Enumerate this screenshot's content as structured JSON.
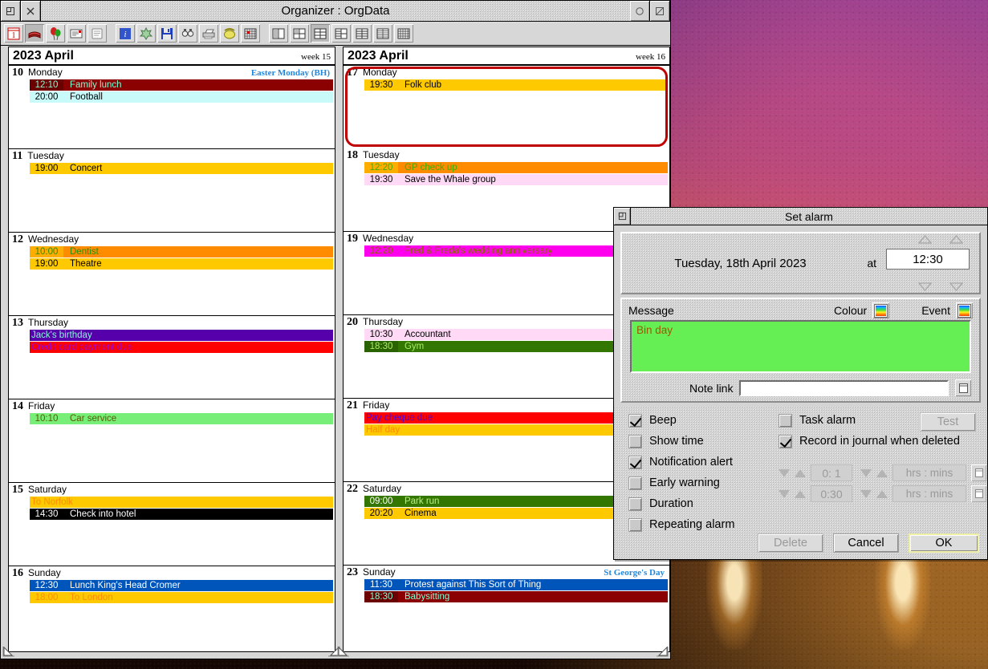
{
  "desktop": {
    "background_note": "abstract purple-orange photo"
  },
  "window": {
    "title": "Organizer : OrgData",
    "titlebar_buttons": [
      {
        "name": "toggle-size",
        "glyph": "box"
      },
      {
        "name": "close",
        "glyph": "x"
      },
      {
        "name": "toggle-full-size",
        "glyph": "circle"
      },
      {
        "name": "adjust-size",
        "glyph": "arrow"
      }
    ],
    "toolbar": [
      {
        "name": "calendar-icon",
        "label": "Calendar",
        "selected": false
      },
      {
        "name": "address-book-icon",
        "label": "Address book",
        "selected": true
      },
      {
        "name": "balloons-icon",
        "label": "Anniversaries",
        "selected": false
      },
      {
        "name": "notes-icon",
        "label": "Notes",
        "selected": false
      },
      {
        "name": "todo-icon",
        "label": "To do",
        "selected": false
      },
      {
        "name": "info-icon",
        "label": "Info",
        "selected": false
      },
      {
        "name": "settings-icon",
        "label": "Settings",
        "selected": false
      },
      {
        "name": "save-icon",
        "label": "Save",
        "selected": false
      },
      {
        "name": "find-icon",
        "label": "Find",
        "selected": false
      },
      {
        "name": "print-icon",
        "label": "Print",
        "selected": false
      },
      {
        "name": "phone-icon",
        "label": "Dial",
        "selected": false
      },
      {
        "name": "grid-icon",
        "label": "Year view",
        "selected": false
      },
      {
        "name": "view-1-icon",
        "label": "One column view",
        "selected": false
      },
      {
        "name": "view-2-icon",
        "label": "Two column view",
        "selected": false
      },
      {
        "name": "view-3-icon",
        "label": "Week view",
        "selected": true
      },
      {
        "name": "view-4-icon",
        "label": "Split view",
        "selected": false
      },
      {
        "name": "view-5-icon",
        "label": "Two week view",
        "selected": false
      },
      {
        "name": "view-6-icon",
        "label": "Month list view",
        "selected": false
      },
      {
        "name": "view-7-icon",
        "label": "Month grid view",
        "selected": false
      }
    ]
  },
  "panes": [
    {
      "month": "2023 April",
      "week": "week 15",
      "days": [
        {
          "num": "10",
          "name": "Monday",
          "note": "Easter Monday (BH)",
          "selected": false,
          "entries": [
            {
              "time": "12:10",
              "text": "Family lunch",
              "bar_bg": "#8b0000",
              "bar_fg": "#7fffd4",
              "time_bg": "#6b0000",
              "time_fg": "#7fffd4"
            },
            {
              "time": "20:00",
              "text": "Football",
              "bar_bg": "#c8fafa",
              "bar_fg": "#000000",
              "time_bg": "#c8fafa",
              "time_fg": "#000000"
            }
          ]
        },
        {
          "num": "11",
          "name": "Tuesday",
          "note": "",
          "selected": false,
          "entries": [
            {
              "time": "19:00",
              "text": "Concert",
              "bar_bg": "#ffc900",
              "bar_fg": "#000000",
              "time_bg": "#ffc900",
              "time_fg": "#000000"
            }
          ]
        },
        {
          "num": "12",
          "name": "Wednesday",
          "note": "",
          "selected": false,
          "entries": [
            {
              "time": "10:00",
              "text": "Dentist",
              "bar_bg": "#ff8c00",
              "bar_fg": "#2e8b00",
              "time_bg": "#ffae00",
              "time_fg": "#2e8b00"
            },
            {
              "time": "19:00",
              "text": "Theatre",
              "bar_bg": "#ffc900",
              "bar_fg": "#000000",
              "time_bg": "#ffc900",
              "time_fg": "#000000"
            }
          ]
        },
        {
          "num": "13",
          "name": "Thursday",
          "note": "",
          "selected": false,
          "entries": [
            {
              "time": "",
              "text": "Jack's birthday",
              "bar_bg": "#5500aa",
              "bar_fg": "#7fffd4",
              "time_bg": "#5500aa",
              "time_fg": "#7fffd4"
            },
            {
              "time": "",
              "text": "Credit card payment due",
              "bar_bg": "#ff0000",
              "bar_fg": "#9900cc",
              "time_bg": "#ff0000",
              "time_fg": "#9900cc"
            }
          ]
        },
        {
          "num": "14",
          "name": "Friday",
          "note": "",
          "selected": false,
          "entries": [
            {
              "time": "10:10",
              "text": "Car service",
              "bar_bg": "#77ee77",
              "bar_fg": "#5a5a00",
              "time_bg": "#77ee77",
              "time_fg": "#5a5a00"
            }
          ]
        },
        {
          "num": "15",
          "name": "Saturday",
          "note": "",
          "selected": false,
          "entries": [
            {
              "time": "",
              "text": "To Norfolk",
              "bar_bg": "#ffc900",
              "bar_fg": "#ff8c00",
              "time_bg": "#ffc900",
              "time_fg": "#ff8c00"
            },
            {
              "time": "14:30",
              "text": "Check into hotel",
              "bar_bg": "#000000",
              "bar_fg": "#ffffff",
              "time_bg": "#000000",
              "time_fg": "#ffffff"
            }
          ]
        },
        {
          "num": "16",
          "name": "Sunday",
          "note": "",
          "selected": false,
          "entries": [
            {
              "time": "12:30",
              "text": "Lunch King's Head Cromer",
              "bar_bg": "#0055bb",
              "bar_fg": "#ffffff",
              "time_bg": "#0055bb",
              "time_fg": "#ffffff"
            },
            {
              "time": "18:00",
              "text": "To London",
              "bar_bg": "#ffc900",
              "bar_fg": "#ff8c00",
              "time_bg": "#ffc900",
              "time_fg": "#ff8c00"
            }
          ]
        }
      ]
    },
    {
      "month": "2023 April",
      "week": "week 16",
      "days": [
        {
          "num": "17",
          "name": "Monday",
          "note": "",
          "selected": true,
          "entries": [
            {
              "time": "19:30",
              "text": "Folk club",
              "bar_bg": "#ffc900",
              "bar_fg": "#000000",
              "time_bg": "#ffc900",
              "time_fg": "#000000"
            }
          ]
        },
        {
          "num": "18",
          "name": "Tuesday",
          "note": "",
          "selected": false,
          "entries": [
            {
              "time": "12:20",
              "text": "GP check up",
              "bar_bg": "#ff8c00",
              "bar_fg": "#44aa00",
              "time_bg": "#ffae00",
              "time_fg": "#44aa00"
            },
            {
              "time": "19:30",
              "text": "Save the Whale group",
              "bar_bg": "#ffd9f5",
              "bar_fg": "#000000",
              "time_bg": "#ffd9f5",
              "time_fg": "#000000"
            }
          ]
        },
        {
          "num": "19",
          "name": "Wednesday",
          "note": "",
          "selected": false,
          "entries": [
            {
              "time": "12:20",
              "text": "Fred & Freda's wedding anniversary",
              "bar_bg": "#ff00ee",
              "bar_fg": "#8b6a00",
              "time_bg": "#ff00ee",
              "time_fg": "#8b6a00"
            }
          ]
        },
        {
          "num": "20",
          "name": "Thursday",
          "note": "",
          "selected": false,
          "entries": [
            {
              "time": "10:30",
              "text": "Accountant",
              "bar_bg": "#ffd9f5",
              "bar_fg": "#000000",
              "time_bg": "#ffd9f5",
              "time_fg": "#000000"
            },
            {
              "time": "18:30",
              "text": "Gym",
              "bar_bg": "#337700",
              "bar_fg": "#aaee66",
              "time_bg": "#2a6200",
              "time_fg": "#aaee66"
            }
          ]
        },
        {
          "num": "21",
          "name": "Friday",
          "note": "",
          "selected": false,
          "entries": [
            {
              "time": "",
              "text": "Pay cheque due",
              "bar_bg": "#ff0000",
              "bar_fg": "#5500cc",
              "time_bg": "#ff0000",
              "time_fg": "#5500cc"
            },
            {
              "time": "",
              "text": "Half day",
              "bar_bg": "#ffc900",
              "bar_fg": "#ff8c00",
              "time_bg": "#ffc900",
              "time_fg": "#ff8c00"
            }
          ]
        },
        {
          "num": "22",
          "name": "Saturday",
          "note": "",
          "selected": false,
          "entries": [
            {
              "time": "09:00",
              "text": "Park run",
              "bar_bg": "#337700",
              "bar_fg": "#bbee88",
              "time_bg": "#337700",
              "time_fg": "#ffffff"
            },
            {
              "time": "20:20",
              "text": "Cinema",
              "bar_bg": "#ffc900",
              "bar_fg": "#000000",
              "time_bg": "#ffc900",
              "time_fg": "#000000"
            }
          ]
        },
        {
          "num": "23",
          "name": "Sunday",
          "note": "St George's Day",
          "selected": false,
          "entries": [
            {
              "time": "11:30",
              "text": "Protest against This Sort of Thing",
              "bar_bg": "#0055bb",
              "bar_fg": "#ffffff",
              "time_bg": "#0055bb",
              "time_fg": "#ffffff"
            },
            {
              "time": "18:30",
              "text": "Babysitting",
              "bar_bg": "#8b0000",
              "bar_fg": "#7fffd4",
              "time_bg": "#6b0000",
              "time_fg": "#7fffd4"
            }
          ]
        }
      ]
    }
  ],
  "alarm": {
    "title": "Set alarm",
    "date_text": "Tuesday, 18th April 2023",
    "at_label": "at",
    "time_value": "12:30",
    "message_label": "Message",
    "colour_label": "Colour",
    "event_label": "Event",
    "message_value": "Bin day",
    "message_bg": "#66ee55",
    "message_fg": "#9a5a00",
    "note_link_label": "Note link",
    "note_link_value": "",
    "checkboxes_left": [
      {
        "label": "Beep",
        "checked": true
      },
      {
        "label": "Show time",
        "checked": false
      },
      {
        "label": "Notification alert",
        "checked": true
      },
      {
        "label": "Early warning",
        "checked": false
      },
      {
        "label": "Duration",
        "checked": false
      },
      {
        "label": "Repeating alarm",
        "checked": false
      }
    ],
    "checkboxes_right": [
      {
        "label": "Task alarm",
        "checked": false
      },
      {
        "label": "Record in journal when deleted",
        "checked": true
      }
    ],
    "test_label": "Test",
    "spinners": [
      {
        "value": "0: 1",
        "unit": "hrs : mins"
      },
      {
        "value": "0:30",
        "unit": "hrs : mins"
      }
    ],
    "buttons": [
      {
        "label": "Delete",
        "state": "disabled"
      },
      {
        "label": "Cancel",
        "state": "normal"
      },
      {
        "label": "OK",
        "state": "default"
      }
    ]
  }
}
